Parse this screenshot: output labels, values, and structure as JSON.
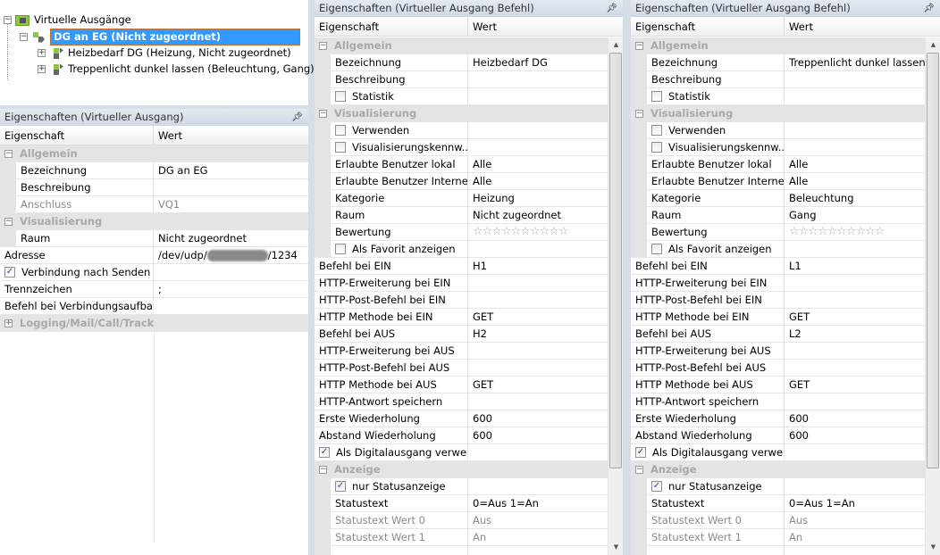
{
  "tree": {
    "root": "Virtuelle Ausgänge",
    "selected": "DG an EG (Nicht zugeordnet)",
    "children": [
      "Heizbedarf DG (Heizung, Nicht zugeordnet)",
      "Treppenlicht dunkel lassen (Beleuchtung, Gang)"
    ]
  },
  "left": {
    "title": "Eigenschaften (Virtueller Ausgang)",
    "col1": "Eigenschaft",
    "col2": "Wert",
    "address_prefix": "/dev/udp/",
    "address_suffix": "/1234",
    "rows": [
      {
        "t": "group",
        "label": "Allgemein",
        "open": true
      },
      {
        "t": "item",
        "label": "Bezeichnung",
        "value": "DG an EG",
        "indent": true
      },
      {
        "t": "item",
        "label": "Beschreibung",
        "value": "",
        "indent": true
      },
      {
        "t": "item",
        "label": "Anschluss",
        "value": "VQ1",
        "indent": true,
        "grey": true
      },
      {
        "t": "group",
        "label": "Visualisierung",
        "open": true
      },
      {
        "t": "item",
        "label": "Raum",
        "value": "Nicht zugeordnet",
        "indent": true
      },
      {
        "t": "addr",
        "label": "Adresse"
      },
      {
        "t": "item",
        "label": "Verbindung nach Senden ...",
        "value": "",
        "cb": true,
        "checked": true
      },
      {
        "t": "item",
        "label": "Trennzeichen",
        "value": ";"
      },
      {
        "t": "item",
        "label": "Befehl bei Verbindungsaufbau",
        "value": ""
      },
      {
        "t": "group",
        "label": "Logging/Mail/Call/Track",
        "open": false
      }
    ]
  },
  "panels": [
    {
      "title": "Eigenschaften (Virtueller Ausgang Befehl)",
      "col1": "Eigenschaft",
      "col2": "Wert",
      "rows": [
        {
          "t": "group",
          "label": "Allgemein",
          "open": true
        },
        {
          "t": "item",
          "label": "Bezeichnung",
          "value": "Heizbedarf DG",
          "indent": true
        },
        {
          "t": "item",
          "label": "Beschreibung",
          "value": "",
          "indent": true
        },
        {
          "t": "item",
          "label": "Statistik",
          "value": "",
          "indent": true,
          "cb": true,
          "checked": false
        },
        {
          "t": "group",
          "label": "Visualisierung",
          "open": true
        },
        {
          "t": "item",
          "label": "Verwenden",
          "value": "",
          "indent": true,
          "cb": true,
          "checked": false
        },
        {
          "t": "item",
          "label": "Visualisierungskennw...",
          "value": "",
          "indent": true,
          "cb": true,
          "checked": false
        },
        {
          "t": "item",
          "label": "Erlaubte Benutzer lokal",
          "value": "Alle",
          "indent": true
        },
        {
          "t": "item",
          "label": "Erlaubte Benutzer Internet",
          "value": "Alle",
          "indent": true
        },
        {
          "t": "item",
          "label": "Kategorie",
          "value": "Heizung",
          "indent": true
        },
        {
          "t": "item",
          "label": "Raum",
          "value": "Nicht zugeordnet",
          "indent": true
        },
        {
          "t": "item",
          "label": "Bewertung",
          "value": "☆☆☆☆☆☆☆☆☆☆",
          "indent": true,
          "stars": true
        },
        {
          "t": "item",
          "label": "Als Favorit anzeigen",
          "value": "",
          "indent": true,
          "cb": true,
          "checked": false
        },
        {
          "t": "item",
          "label": "Befehl bei EIN",
          "value": "H1"
        },
        {
          "t": "item",
          "label": "HTTP-Erweiterung bei EIN",
          "value": ""
        },
        {
          "t": "item",
          "label": "HTTP-Post-Befehl bei EIN",
          "value": ""
        },
        {
          "t": "item",
          "label": "HTTP Methode bei EIN",
          "value": "GET"
        },
        {
          "t": "item",
          "label": "Befehl bei AUS",
          "value": "H2"
        },
        {
          "t": "item",
          "label": "HTTP-Erweiterung bei AUS",
          "value": ""
        },
        {
          "t": "item",
          "label": "HTTP-Post-Befehl bei AUS",
          "value": ""
        },
        {
          "t": "item",
          "label": "HTTP Methode bei AUS",
          "value": "GET"
        },
        {
          "t": "item",
          "label": "HTTP-Antwort speichern",
          "value": ""
        },
        {
          "t": "item",
          "label": "Erste Wiederholung",
          "value": "600"
        },
        {
          "t": "item",
          "label": "Abstand Wiederholung",
          "value": "600"
        },
        {
          "t": "item",
          "label": "Als Digitalausgang verwe...",
          "value": "",
          "cb": true,
          "checked": true
        },
        {
          "t": "group",
          "label": "Anzeige",
          "open": true
        },
        {
          "t": "item",
          "label": "nur Statusanzeige",
          "value": "",
          "indent": true,
          "cb": true,
          "checked": true
        },
        {
          "t": "item",
          "label": "Statustext",
          "value": "0=Aus 1=An",
          "indent": true
        },
        {
          "t": "item",
          "label": "Statustext Wert 0",
          "value": "Aus",
          "indent": true,
          "grey": true
        },
        {
          "t": "item",
          "label": "Statustext Wert 1",
          "value": "An",
          "indent": true,
          "grey": true
        },
        {
          "t": "item",
          "label": "",
          "value": "",
          "indent": true
        }
      ]
    },
    {
      "title": "Eigenschaften (Virtueller Ausgang Befehl)",
      "col1": "Eigenschaft",
      "col2": "Wert",
      "rows": [
        {
          "t": "group",
          "label": "Allgemein",
          "open": true
        },
        {
          "t": "item",
          "label": "Bezeichnung",
          "value": "Treppenlicht dunkel lassen",
          "indent": true
        },
        {
          "t": "item",
          "label": "Beschreibung",
          "value": "",
          "indent": true
        },
        {
          "t": "item",
          "label": "Statistik",
          "value": "",
          "indent": true,
          "cb": true,
          "checked": false
        },
        {
          "t": "group",
          "label": "Visualisierung",
          "open": true
        },
        {
          "t": "item",
          "label": "Verwenden",
          "value": "",
          "indent": true,
          "cb": true,
          "checked": false
        },
        {
          "t": "item",
          "label": "Visualisierungskennw...",
          "value": "",
          "indent": true,
          "cb": true,
          "checked": false
        },
        {
          "t": "item",
          "label": "Erlaubte Benutzer lokal",
          "value": "Alle",
          "indent": true
        },
        {
          "t": "item",
          "label": "Erlaubte Benutzer Internet",
          "value": "Alle",
          "indent": true
        },
        {
          "t": "item",
          "label": "Kategorie",
          "value": "Beleuchtung",
          "indent": true
        },
        {
          "t": "item",
          "label": "Raum",
          "value": "Gang",
          "indent": true
        },
        {
          "t": "item",
          "label": "Bewertung",
          "value": "☆☆☆☆☆☆☆☆☆☆",
          "indent": true,
          "stars": true
        },
        {
          "t": "item",
          "label": "Als Favorit anzeigen",
          "value": "",
          "indent": true,
          "cb": true,
          "checked": false
        },
        {
          "t": "item",
          "label": "Befehl bei EIN",
          "value": "L1"
        },
        {
          "t": "item",
          "label": "HTTP-Erweiterung bei EIN",
          "value": ""
        },
        {
          "t": "item",
          "label": "HTTP-Post-Befehl bei EIN",
          "value": ""
        },
        {
          "t": "item",
          "label": "HTTP Methode bei EIN",
          "value": "GET"
        },
        {
          "t": "item",
          "label": "Befehl bei AUS",
          "value": "L2"
        },
        {
          "t": "item",
          "label": "HTTP-Erweiterung bei AUS",
          "value": ""
        },
        {
          "t": "item",
          "label": "HTTP-Post-Befehl bei AUS",
          "value": ""
        },
        {
          "t": "item",
          "label": "HTTP Methode bei AUS",
          "value": "GET"
        },
        {
          "t": "item",
          "label": "HTTP-Antwort speichern",
          "value": ""
        },
        {
          "t": "item",
          "label": "Erste Wiederholung",
          "value": "600"
        },
        {
          "t": "item",
          "label": "Abstand Wiederholung",
          "value": "600"
        },
        {
          "t": "item",
          "label": "Als Digitalausgang verwe...",
          "value": "",
          "cb": true,
          "checked": true
        },
        {
          "t": "group",
          "label": "Anzeige",
          "open": true
        },
        {
          "t": "item",
          "label": "nur Statusanzeige",
          "value": "",
          "indent": true,
          "cb": true,
          "checked": true
        },
        {
          "t": "item",
          "label": "Statustext",
          "value": "0=Aus 1=An",
          "indent": true
        },
        {
          "t": "item",
          "label": "Statustext Wert 0",
          "value": "Aus",
          "indent": true,
          "grey": true
        },
        {
          "t": "item",
          "label": "Statustext Wert 1",
          "value": "An",
          "indent": true,
          "grey": true
        },
        {
          "t": "item",
          "label": "",
          "value": "",
          "indent": true
        }
      ]
    }
  ]
}
